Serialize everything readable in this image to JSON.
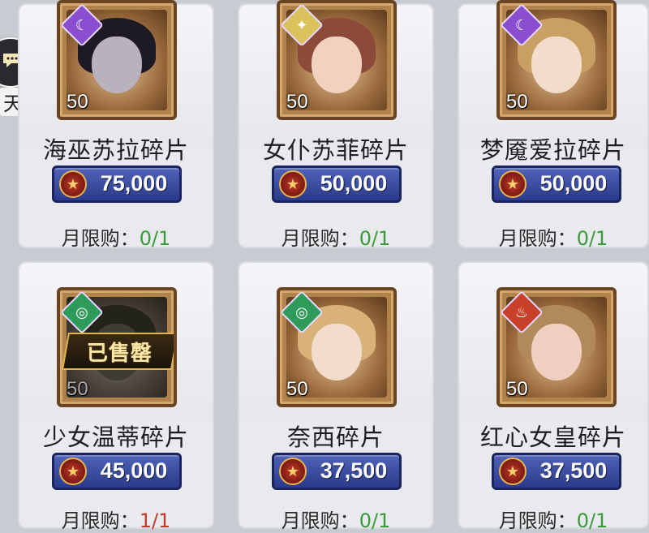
{
  "side": {
    "label": "天"
  },
  "items": [
    {
      "name": "海巫苏拉碎片",
      "level": "50",
      "price": "75,000",
      "limit_label": "月限购：",
      "limit_value": "0/1",
      "element": "moon",
      "element_glyph": "☾",
      "element_color": "#8a4fd0",
      "sold_text": ""
    },
    {
      "name": "女仆苏菲碎片",
      "level": "50",
      "price": "50,000",
      "limit_label": "月限购：",
      "limit_value": "0/1",
      "element": "light",
      "element_glyph": "✦",
      "element_color": "#d9c35a",
      "sold_text": ""
    },
    {
      "name": "梦魇爱拉碎片",
      "level": "50",
      "price": "50,000",
      "limit_label": "月限购：",
      "limit_value": "0/1",
      "element": "moon",
      "element_glyph": "☾",
      "element_color": "#8a4fd0",
      "sold_text": ""
    },
    {
      "name": "少女温蒂碎片",
      "level": "50",
      "price": "45,000",
      "limit_label": "月限购：",
      "limit_value": "1/1",
      "element": "wind",
      "element_glyph": "◎",
      "element_color": "#2f9b5a",
      "sold_text": "已售罄"
    },
    {
      "name": "奈西碎片",
      "level": "50",
      "price": "37,500",
      "limit_label": "月限购：",
      "limit_value": "0/1",
      "element": "wind",
      "element_glyph": "◎",
      "element_color": "#2f9b5a",
      "sold_text": ""
    },
    {
      "name": "红心女皇碎片",
      "level": "50",
      "price": "37,500",
      "limit_label": "月限购：",
      "limit_value": "0/1",
      "element": "fire",
      "element_glyph": "♨",
      "element_color": "#c9402a",
      "sold_text": ""
    }
  ]
}
